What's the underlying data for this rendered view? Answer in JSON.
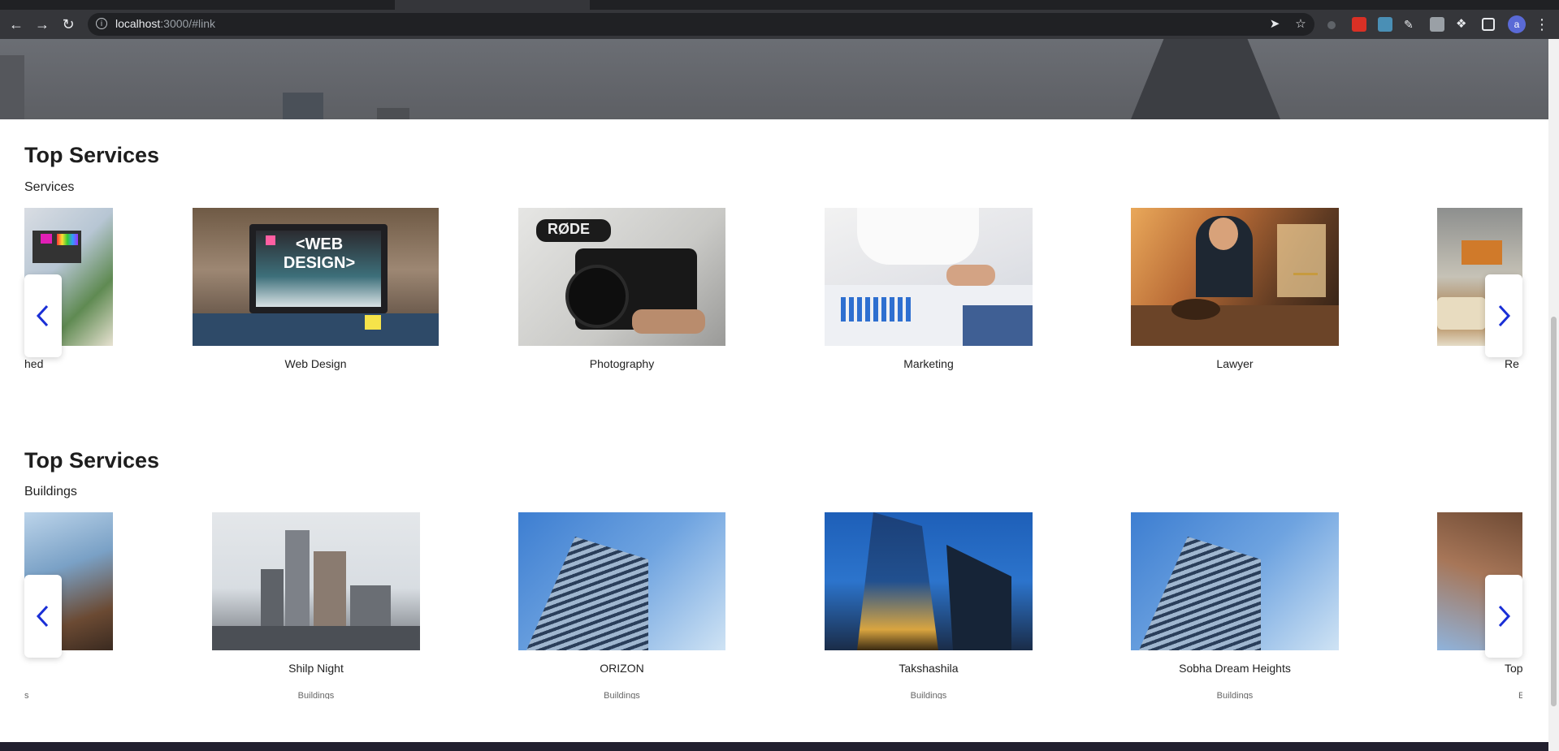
{
  "browser": {
    "url_host": "localhost",
    "url_rest": ":3000/#link",
    "profile_initial": "a"
  },
  "sections": [
    {
      "title": "Top Services",
      "subtitle": "Services",
      "cards": [
        {
          "title": "hed",
          "category": ""
        },
        {
          "title": "Web Design",
          "category": ""
        },
        {
          "title": "Photography",
          "category": ""
        },
        {
          "title": "Marketing",
          "category": ""
        },
        {
          "title": "Lawyer",
          "category": ""
        },
        {
          "title": "Re",
          "category": ""
        }
      ]
    },
    {
      "title": "Top Services",
      "subtitle": "Buildings",
      "cards": [
        {
          "title": "",
          "category": "s"
        },
        {
          "title": "Shilp Night",
          "category": "Buildings"
        },
        {
          "title": "ORIZON",
          "category": "Buildings"
        },
        {
          "title": "Takshashila",
          "category": "Buildings"
        },
        {
          "title": "Sobha Dream Heights",
          "category": "Buildings"
        },
        {
          "title": "Top",
          "category": "E"
        }
      ]
    }
  ],
  "image_texts": {
    "web_design": "<WEB DESIGN>",
    "rode": "RØDE"
  },
  "colors": {
    "arrow": "#1a2fd6",
    "footer": "#22202f"
  }
}
